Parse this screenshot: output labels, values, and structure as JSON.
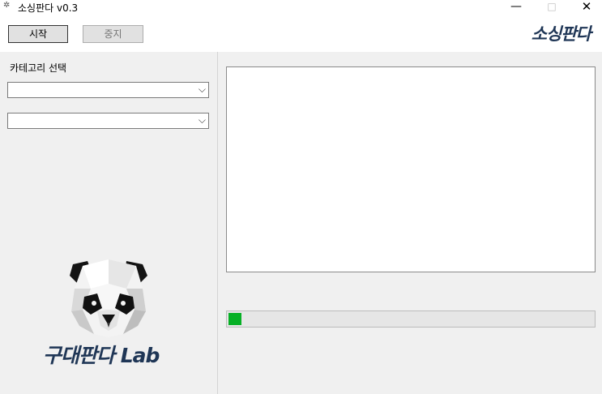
{
  "window": {
    "title": "소싱판다 v0.3",
    "icon": "panda-icon",
    "controls": {
      "minimize": "—",
      "maximize": "□",
      "close": "✕"
    }
  },
  "toolbar": {
    "start_label": "시작",
    "stop_label": "중지",
    "brand": "소싱판다"
  },
  "sidebar": {
    "category_label": "카테고리 선택",
    "select_1": {
      "value": ""
    },
    "select_2": {
      "value": ""
    },
    "logo_text": "구대판다 Lab"
  },
  "main": {
    "log_text": "",
    "progress_fraction": 0.035
  },
  "colors": {
    "brand": "#1f3656",
    "progress": "#06b025",
    "panel": "#f0f0f0"
  }
}
